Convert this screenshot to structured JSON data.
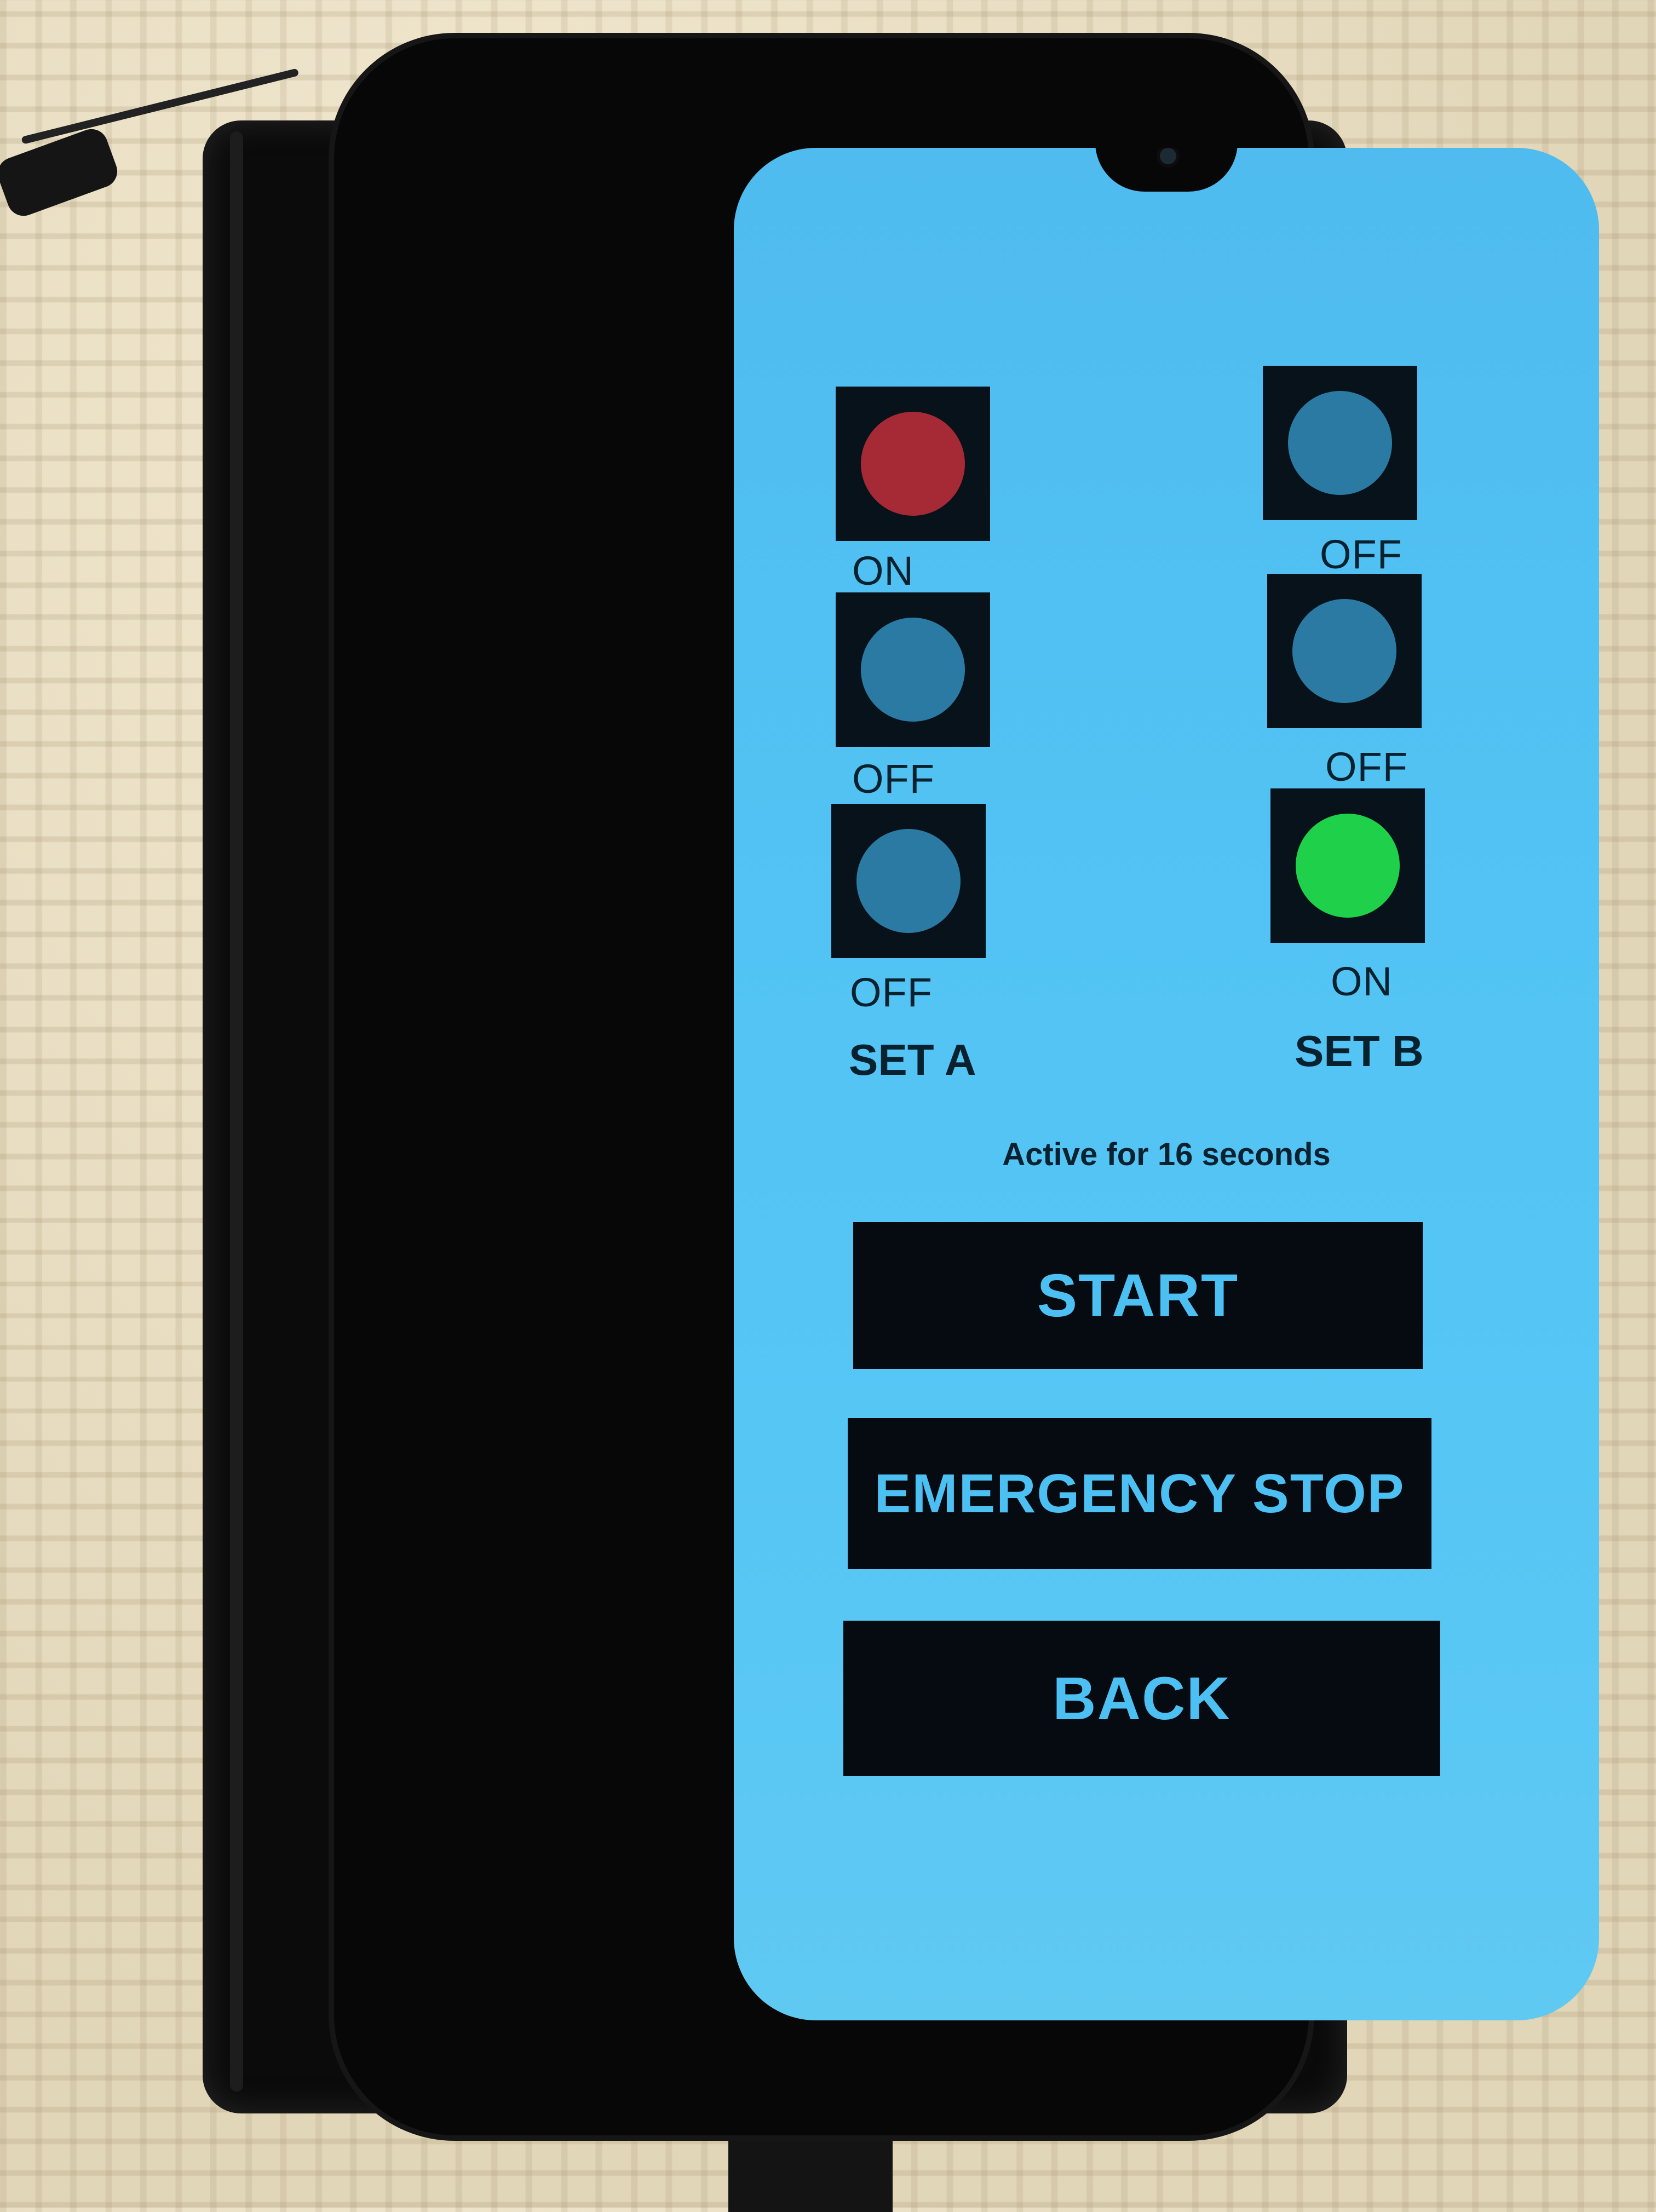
{
  "set_a": {
    "label": "SET A",
    "indicators": [
      {
        "state": "ON",
        "lamp_color": "#a52a36"
      },
      {
        "state": "OFF",
        "lamp_color": "#2a7aa3"
      },
      {
        "state": "OFF",
        "lamp_color": "#2a7aa3"
      }
    ]
  },
  "set_b": {
    "label": "SET B",
    "indicators": [
      {
        "state": "OFF",
        "lamp_color": "#2a7aa3"
      },
      {
        "state": "OFF",
        "lamp_color": "#2a7aa3"
      },
      {
        "state": "ON",
        "lamp_color": "#1fd14a"
      }
    ]
  },
  "status": {
    "text": "Active for 16 seconds"
  },
  "buttons": {
    "start": "START",
    "emergency_stop": "EMERGENCY STOP",
    "back": "BACK"
  },
  "colors": {
    "screen_background": "#52c3f4",
    "button_background": "#050b10",
    "button_text": "#4cc0f2"
  }
}
